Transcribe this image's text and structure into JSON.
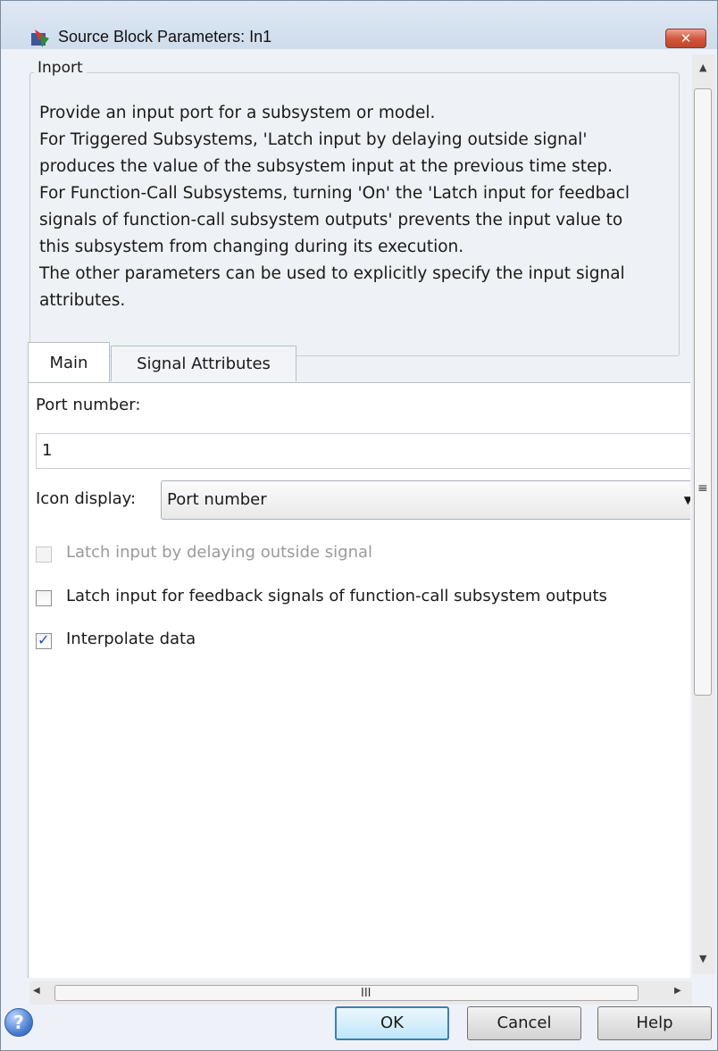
{
  "window": {
    "title": "Source Block Parameters: In1",
    "close_label": "✕"
  },
  "group": {
    "label": "Inport",
    "description_lines": [
      "Provide an input port for a subsystem or model.",
      "For Triggered Subsystems, 'Latch input by delaying outside signal'",
      "produces the value of the subsystem input at the previous time step.",
      "For Function-Call Subsystems, turning 'On' the 'Latch input for feedbacl",
      "signals of function-call subsystem outputs' prevents the input value to",
      "this subsystem from changing during its execution.",
      "The other parameters can be used to explicitly specify the input signal",
      "attributes."
    ]
  },
  "tabs": [
    {
      "label": "Main",
      "active": true
    },
    {
      "label": "Signal Attributes",
      "active": false
    }
  ],
  "main": {
    "port_number_label": "Port number:",
    "port_number_value": "1",
    "icon_display_label": "Icon display:",
    "icon_display_value": "Port number",
    "checkboxes": [
      {
        "label": "Latch input by delaying outside signal",
        "checked": false,
        "enabled": false
      },
      {
        "label": "Latch input for feedback signals of function-call subsystem outputs",
        "checked": false,
        "enabled": true
      },
      {
        "label": "Interpolate data",
        "checked": true,
        "enabled": true
      }
    ]
  },
  "scrollbars": {
    "grip_glyph": "III",
    "vertical_grip": "≡"
  },
  "buttons": {
    "ok": "OK",
    "cancel": "Cancel",
    "help": "Help",
    "help_icon": "?"
  }
}
